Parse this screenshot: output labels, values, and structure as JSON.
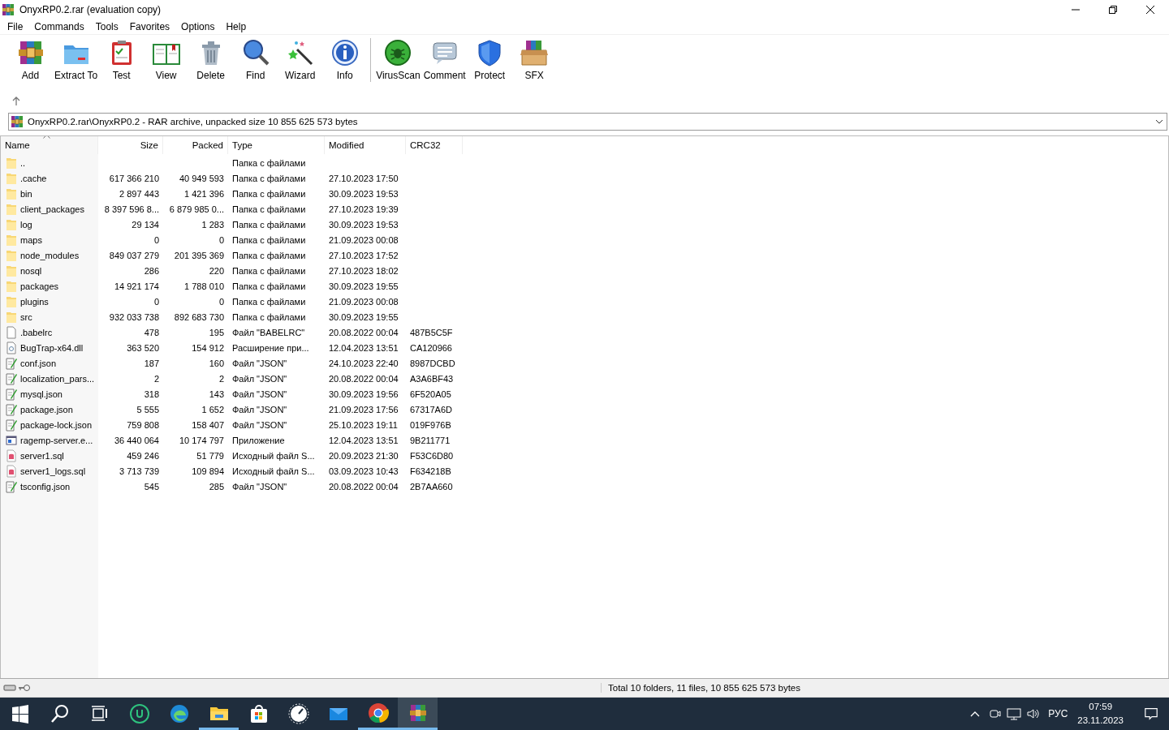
{
  "window": {
    "title": "OnyxRP0.2.rar (evaluation copy)"
  },
  "menu": [
    "File",
    "Commands",
    "Tools",
    "Favorites",
    "Options",
    "Help"
  ],
  "toolbar": {
    "main": [
      {
        "label": "Add",
        "kind": "add"
      },
      {
        "label": "Extract To",
        "kind": "extract"
      },
      {
        "label": "Test",
        "kind": "test"
      },
      {
        "label": "View",
        "kind": "view"
      },
      {
        "label": "Delete",
        "kind": "delete"
      },
      {
        "label": "Find",
        "kind": "find"
      },
      {
        "label": "Wizard",
        "kind": "wizard"
      },
      {
        "label": "Info",
        "kind": "info"
      }
    ],
    "extra": [
      {
        "label": "VirusScan",
        "kind": "virus"
      },
      {
        "label": "Comment",
        "kind": "comment"
      },
      {
        "label": "Protect",
        "kind": "protect"
      },
      {
        "label": "SFX",
        "kind": "sfx"
      }
    ]
  },
  "address": "OnyxRP0.2.rar\\OnyxRP0.2 - RAR archive, unpacked size 10 855 625 573 bytes",
  "table": {
    "columns": [
      {
        "label": "Name",
        "sorted": true
      },
      {
        "label": "Size",
        "sorted": false
      },
      {
        "label": "Packed",
        "sorted": false
      },
      {
        "label": "Type",
        "sorted": false
      },
      {
        "label": "Modified",
        "sorted": false
      },
      {
        "label": "CRC32",
        "sorted": false
      }
    ],
    "rows": [
      {
        "kind": "folder",
        "name": "..",
        "size": "",
        "packed": "",
        "type": "Папка с файлами",
        "modified": "",
        "crc": ""
      },
      {
        "kind": "folder",
        "name": ".cache",
        "size": "617 366 210",
        "packed": "40 949 593",
        "type": "Папка с файлами",
        "modified": "27.10.2023 17:50",
        "crc": ""
      },
      {
        "kind": "folder",
        "name": "bin",
        "size": "2 897 443",
        "packed": "1 421 396",
        "type": "Папка с файлами",
        "modified": "30.09.2023 19:53",
        "crc": ""
      },
      {
        "kind": "folder",
        "name": "client_packages",
        "size": "8 397 596 8...",
        "packed": "6 879 985 0...",
        "type": "Папка с файлами",
        "modified": "27.10.2023 19:39",
        "crc": ""
      },
      {
        "kind": "folder",
        "name": "log",
        "size": "29 134",
        "packed": "1 283",
        "type": "Папка с файлами",
        "modified": "30.09.2023 19:53",
        "crc": ""
      },
      {
        "kind": "folder",
        "name": "maps",
        "size": "0",
        "packed": "0",
        "type": "Папка с файлами",
        "modified": "21.09.2023 00:08",
        "crc": ""
      },
      {
        "kind": "folder",
        "name": "node_modules",
        "size": "849 037 279",
        "packed": "201 395 369",
        "type": "Папка с файлами",
        "modified": "27.10.2023 17:52",
        "crc": ""
      },
      {
        "kind": "folder",
        "name": "nosql",
        "size": "286",
        "packed": "220",
        "type": "Папка с файлами",
        "modified": "27.10.2023 18:02",
        "crc": ""
      },
      {
        "kind": "folder",
        "name": "packages",
        "size": "14 921 174",
        "packed": "1 788 010",
        "type": "Папка с файлами",
        "modified": "30.09.2023 19:55",
        "crc": ""
      },
      {
        "kind": "folder",
        "name": "plugins",
        "size": "0",
        "packed": "0",
        "type": "Папка с файлами",
        "modified": "21.09.2023 00:08",
        "crc": ""
      },
      {
        "kind": "folder",
        "name": "src",
        "size": "932 033 738",
        "packed": "892 683 730",
        "type": "Папка с файлами",
        "modified": "30.09.2023 19:55",
        "crc": ""
      },
      {
        "kind": "file",
        "name": ".babelrc",
        "size": "478",
        "packed": "195",
        "type": "Файл \"BABELRC\"",
        "modified": "20.08.2022 00:04",
        "crc": "487B5C5F"
      },
      {
        "kind": "dll",
        "name": "BugTrap-x64.dll",
        "size": "363 520",
        "packed": "154 912",
        "type": "Расширение при...",
        "modified": "12.04.2023 13:51",
        "crc": "CA120966"
      },
      {
        "kind": "json",
        "name": "conf.json",
        "size": "187",
        "packed": "160",
        "type": "Файл \"JSON\"",
        "modified": "24.10.2023 22:40",
        "crc": "8987DCBD"
      },
      {
        "kind": "json",
        "name": "localization_pars...",
        "size": "2",
        "packed": "2",
        "type": "Файл \"JSON\"",
        "modified": "20.08.2022 00:04",
        "crc": "A3A6BF43"
      },
      {
        "kind": "json",
        "name": "mysql.json",
        "size": "318",
        "packed": "143",
        "type": "Файл \"JSON\"",
        "modified": "30.09.2023 19:56",
        "crc": "6F520A05"
      },
      {
        "kind": "json",
        "name": "package.json",
        "size": "5 555",
        "packed": "1 652",
        "type": "Файл \"JSON\"",
        "modified": "21.09.2023 17:56",
        "crc": "67317A6D"
      },
      {
        "kind": "json",
        "name": "package-lock.json",
        "size": "759 808",
        "packed": "158 407",
        "type": "Файл \"JSON\"",
        "modified": "25.10.2023 19:11",
        "crc": "019F976B"
      },
      {
        "kind": "exe",
        "name": "ragemp-server.e...",
        "size": "36 440 064",
        "packed": "10 174 797",
        "type": "Приложение",
        "modified": "12.04.2023 13:51",
        "crc": "9B211771"
      },
      {
        "kind": "sql",
        "name": "server1.sql",
        "size": "459 246",
        "packed": "51 779",
        "type": "Исходный файл S...",
        "modified": "20.09.2023 21:30",
        "crc": "F53C6D80"
      },
      {
        "kind": "sql",
        "name": "server1_logs.sql",
        "size": "3 713 739",
        "packed": "109 894",
        "type": "Исходный файл S...",
        "modified": "03.09.2023 10:43",
        "crc": "F634218B"
      },
      {
        "kind": "json",
        "name": "tsconfig.json",
        "size": "545",
        "packed": "285",
        "type": "Файл \"JSON\"",
        "modified": "20.08.2022 00:04",
        "crc": "2B7AA660"
      }
    ]
  },
  "status_bar": {
    "text": "Total 10 folders, 11 files, 10 855 625 573 bytes"
  },
  "taskbar": {
    "apps": [
      {
        "kind": "start",
        "running": false,
        "selected": false
      },
      {
        "kind": "search",
        "running": false,
        "selected": false
      },
      {
        "kind": "taskview",
        "running": false,
        "selected": false
      },
      {
        "kind": "u",
        "running": false,
        "selected": false
      },
      {
        "kind": "edge",
        "running": false,
        "selected": false
      },
      {
        "kind": "explorer",
        "running": true,
        "selected": false
      },
      {
        "kind": "store",
        "running": false,
        "selected": false
      },
      {
        "kind": "gauge",
        "running": false,
        "selected": false
      },
      {
        "kind": "mail",
        "running": false,
        "selected": false
      },
      {
        "kind": "chrome",
        "running": true,
        "selected": false
      },
      {
        "kind": "winrar",
        "running": true,
        "selected": true
      }
    ],
    "language": "РУС",
    "time": "07:59",
    "date": "23.11.2023"
  }
}
